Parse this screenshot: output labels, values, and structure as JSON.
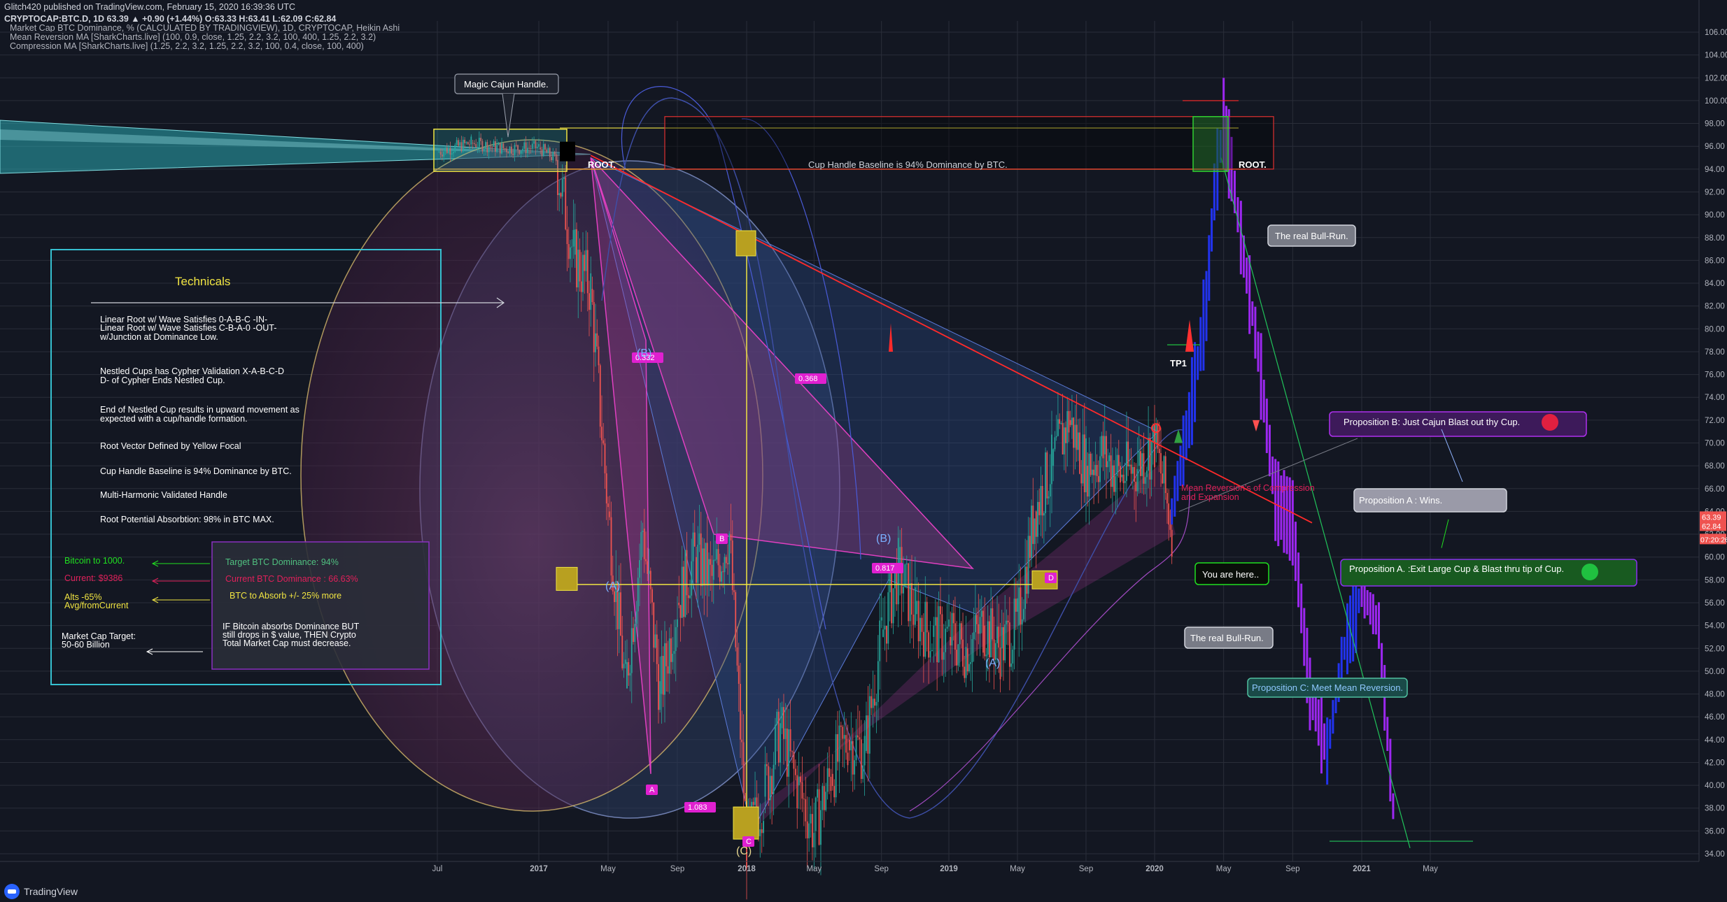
{
  "header": {
    "line1": "Glitch420 published on TradingView.com, February 15, 2020 16:39:36 UTC",
    "line2": "CRYPTOCAP:BTC.D, 1D 63.39 ▲ +0.90 (+1.44%) O:63.33 H:63.41 L:62.09 C:62.84",
    "title": "Market Cap BTC Dominance, % (CALCULATED BY TRADINGVIEW), 1D, CRYPTOCAP, Heikin Ashi",
    "indicator1": "Mean Reversion MA [SharkCharts.live] (100, 0.9, close, 1.25, 2.2, 3.2, 100, 400, 1.25, 2.2, 3.2)",
    "indicator2": "Compression MA [SharkCharts.live] (1.25, 2.2, 3.2, 1.25, 2.2, 3.2, 100, 0.4, close, 100, 400)"
  },
  "brand": "TradingView",
  "colors": {
    "background": "#131722",
    "grid": "#2a2e39",
    "candle_up": "#26a69a",
    "candle_down": "#ef5350",
    "projection": "#9c27f0",
    "accent_yellow": "#f0e442",
    "accent_red": "#ff2a2a"
  },
  "chart_data": {
    "type": "line",
    "style": "Heikin Ashi candles",
    "ylim": [
      34,
      107
    ],
    "yticks": [
      "106.00",
      "104.00",
      "102.00",
      "100.00",
      "98.00",
      "96.00",
      "94.00",
      "92.00",
      "90.00",
      "88.00",
      "86.00",
      "84.00",
      "82.00",
      "80.00",
      "78.00",
      "76.00",
      "74.00",
      "72.00",
      "70.00",
      "68.00",
      "66.00",
      "64.00",
      "62.00",
      "60.00",
      "58.00",
      "56.00",
      "54.00",
      "52.00",
      "50.00",
      "48.00",
      "46.00",
      "44.00",
      "42.00",
      "40.00",
      "38.00",
      "36.00",
      "34.00"
    ],
    "xticks": [
      "Jul",
      "2017",
      "May",
      "Sep",
      "2018",
      "May",
      "Sep",
      "2019",
      "May",
      "Sep",
      "2020",
      "May",
      "Sep",
      "2021",
      "May"
    ],
    "price_labels": {
      "last": "63.39",
      "close": "62.84",
      "countdown": "07:20:26"
    },
    "grid": true,
    "series": [
      {
        "type": "price",
        "x": [
          "2016-07",
          "2016-09",
          "2016-11",
          "2017-01",
          "2017-02",
          "2017-03",
          "2017-04",
          "2017-05",
          "2017-06",
          "2017-07",
          "2017-08",
          "2017-09",
          "2017-10",
          "2017-11",
          "2017-12",
          "2018-01",
          "2018-02",
          "2018-03",
          "2018-04",
          "2018-05",
          "2018-06",
          "2018-07",
          "2018-08",
          "2018-09",
          "2018-10",
          "2018-11",
          "2018-12",
          "2019-01",
          "2019-02",
          "2019-03",
          "2019-04",
          "2019-05",
          "2019-06",
          "2019-07",
          "2019-08",
          "2019-09",
          "2019-10",
          "2019-11",
          "2019-12",
          "2020-01",
          "2020-02"
        ],
        "y": [
          95.5,
          96.3,
          95.8,
          95.9,
          94.8,
          86.5,
          83.5,
          64,
          48.5,
          62.5,
          48,
          56,
          60,
          58,
          62,
          35,
          39,
          45,
          40,
          36,
          41,
          44,
          43,
          53,
          59,
          55,
          53,
          53,
          52,
          54,
          52,
          54,
          64,
          68,
          72,
          68,
          69,
          67,
          68,
          70,
          62.8
        ]
      },
      {
        "type": "projection",
        "x": [
          "2020-02",
          "2020-03",
          "2020-04",
          "2020-04-15",
          "2020-05",
          "2020-05-15",
          "2020-06",
          "2020-07",
          "2020-08",
          "2020-09",
          "2020-10",
          "2020-11",
          "2020-12",
          "2021-01",
          "2021-02",
          "2021-03"
        ],
        "y": [
          64,
          72,
          82,
          92,
          98,
          94,
          88,
          78,
          65,
          63,
          48,
          43,
          52,
          57,
          54,
          35
        ]
      }
    ]
  },
  "annotations": {
    "magic_cajun": "Magic Cajun Handle.",
    "root_left": "ROOT.",
    "root_right": "ROOT.",
    "cup_baseline": "Cup Handle Baseline is 94% Dominance by BTC.",
    "real_bull_top": "The real Bull-Run.",
    "real_bull_bottom": "The real Bull-Run.",
    "you_are_here": "You are here..",
    "tp1": "TP1",
    "mean_reversion": "Mean Reversion's of Compression and Expansion",
    "prop_b": "Proposition B: Just Cajun Blast out thy Cup.",
    "prop_a_wins": "Proposition A : Wins.",
    "prop_a": "Proposition A. :Exit Large Cup & Blast thru tip of Cup.",
    "prop_c": "Proposition C: Meet Mean Reversion.",
    "fib_0332": "0.332",
    "fib_0368": "0.368",
    "fib_0817": "0.817",
    "fib_1083": "1.083",
    "wave_b1": "(B)",
    "wave_a1": "(A)",
    "wave_b2": "(B)",
    "wave_a2": "(A)",
    "wave_c": "(C)",
    "pt_a": "A",
    "pt_b": "B",
    "pt_c": "C",
    "pt_d": "D"
  },
  "technicals": {
    "title": "Technicals",
    "lines": [
      "Linear Root w/ Wave Satisfies 0-A-B-C -IN-",
      "Linear Root w/ Wave Satisfies C-B-A-0 -OUT-",
      "w/Junction at Dominance Low.",
      "Nestled Cups has Cypher Validation X-A-B-C-D",
      "D- of Cypher Ends Nestled Cup.",
      "End of Nestled Cup results in upward movement as",
      "expected with a cup/handle formation.",
      "Root Vector Defined by Yellow Focal",
      "Cup Handle Baseline is 94% Dominance by BTC.",
      "Multi-Harmonic Validated Handle",
      "Root Potential Absorbtion: 98% in BTC MAX."
    ],
    "left": {
      "bitcoin": "Bitcoin to 1000.",
      "current": "Current: $9386",
      "alts1": "Alts -65%",
      "alts2": "Avg/fromCurrent",
      "mcap1": "Market Cap Target:",
      "mcap2": "50-60 Billion"
    },
    "right": {
      "target": "Target BTC Dominance: 94%",
      "current": "Current BTC Dominance : 66.63%",
      "absorb": "BTC to Absorb +/- 25% more",
      "note1": "IF Bitcoin absorbs Dominance BUT",
      "note2": "still drops in $ value, THEN Crypto",
      "note3": "Total Market Cap must decrease."
    }
  }
}
